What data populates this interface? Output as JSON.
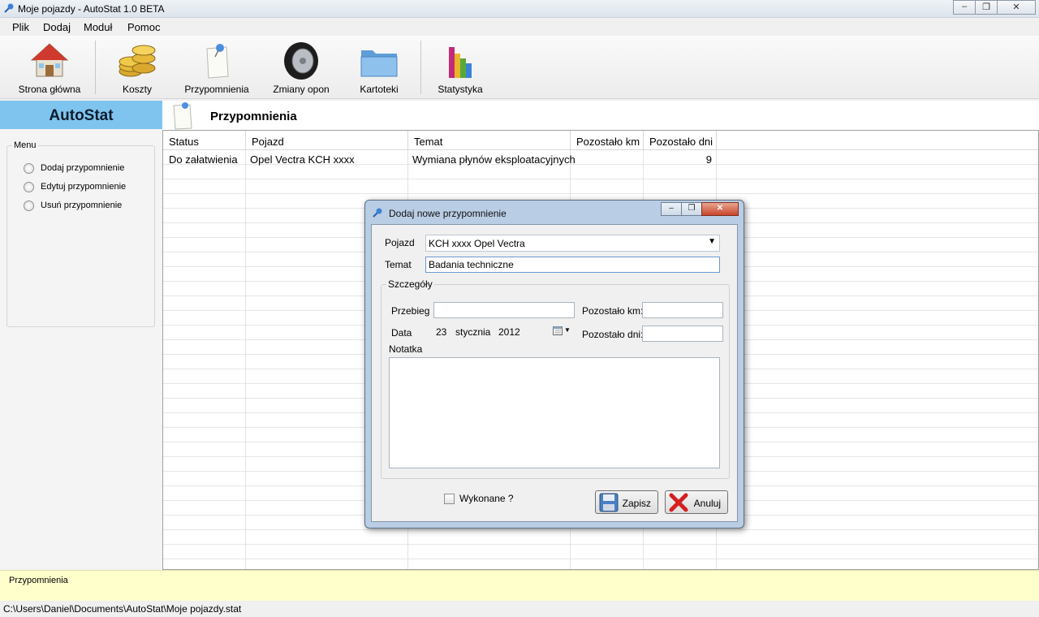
{
  "window": {
    "title": "Moje pojazdy - AutoStat 1.0 BETA",
    "controls": {
      "minimize": "–",
      "maximize": "❐",
      "close": "✕"
    }
  },
  "menubar": [
    "Plik",
    "Dodaj",
    "Moduł",
    "Pomoc"
  ],
  "toolbar": [
    {
      "label": "Strona główna",
      "icon": "home-icon"
    },
    {
      "label": "Koszty",
      "icon": "coins-icon"
    },
    {
      "label": "Przypomnienia",
      "icon": "pin-note-icon"
    },
    {
      "label": "Zmiany opon",
      "icon": "tire-icon"
    },
    {
      "label": "Kartoteki",
      "icon": "folder-icon"
    },
    {
      "label": "Statystyka",
      "icon": "bar-chart-icon"
    }
  ],
  "brand": "AutoStat",
  "sidebar": {
    "group_label": "Menu",
    "options": [
      "Dodaj przypomnienie",
      "Edytuj przypomnienie",
      "Usuń przypomnienie"
    ]
  },
  "content": {
    "title": "Przypomnienia",
    "columns": [
      "Status",
      "Pojazd",
      "Temat",
      "Pozostało km",
      "Pozostało dni"
    ],
    "rows": [
      {
        "status": "Do załatwienia",
        "pojazd": "Opel Vectra KCH xxxx",
        "temat": "Wymiana płynów eksploatacyjnych",
        "km": "",
        "dni": "9"
      }
    ]
  },
  "status_panel": "Przypomnienia",
  "file_path": "C:\\Users\\Daniel\\Documents\\AutoStat\\Moje pojazdy.stat",
  "dialog": {
    "title": "Dodaj nowe przypomnienie",
    "pojazd_label": "Pojazd",
    "pojazd_value": "KCH xxxx Opel Vectra",
    "temat_label": "Temat",
    "temat_value": "Badania techniczne",
    "szczegoly_label": "Szczegóły",
    "przebieg_label": "Przebieg",
    "przebieg_value": "",
    "pozostalo_km_label": "Pozostało km:",
    "pozostalo_km_value": "",
    "data_label": "Data",
    "date_day": "23",
    "date_month": "stycznia",
    "date_year": "2012",
    "pozostalo_dni_label": "Pozostało dni:",
    "pozostalo_dni_value": "",
    "notatka_label": "Notatka",
    "notatka_value": "",
    "wykonane_label": "Wykonane ?",
    "wykonane_checked": false,
    "save_label": "Zapisz",
    "cancel_label": "Anuluj"
  },
  "colors": {
    "brand_bg": "#7fc4ee",
    "status_bg": "#ffffcc",
    "dialog_frame": "#b9cde4"
  }
}
